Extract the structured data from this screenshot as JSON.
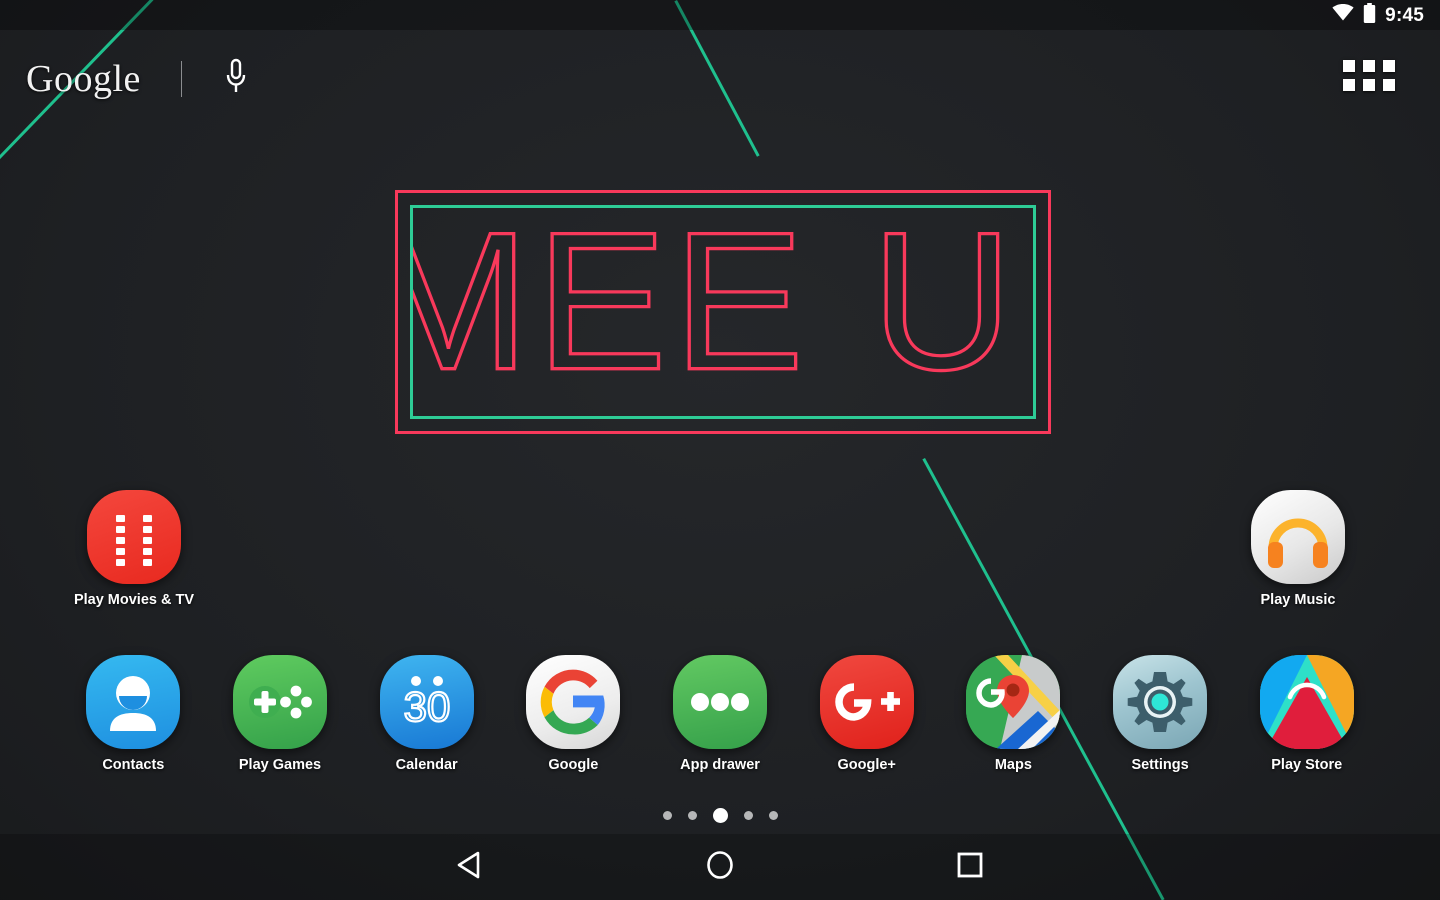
{
  "status_bar": {
    "wifi_icon": "wifi-icon",
    "battery_icon": "battery-icon",
    "time": "9:45"
  },
  "search_widget": {
    "brand": "Google",
    "mic_icon": "microphone-icon"
  },
  "drawer_button": {
    "icon": "apps-grid-icon"
  },
  "wallpaper": {
    "logo_text": "MEE UI",
    "logo_outer_color": "#f8395b",
    "logo_inner_color": "#2ecc96",
    "line_color": "#1fc08e",
    "background_color": "#1e2023"
  },
  "home_screen": {
    "top_row": [
      {
        "label": "Play Movies & TV",
        "icon": "play-movies-icon"
      },
      {
        "label": "Play Music",
        "icon": "play-music-icon"
      }
    ],
    "dock_row": [
      {
        "label": "Contacts",
        "icon": "contacts-icon"
      },
      {
        "label": "Play Games",
        "icon": "play-games-icon"
      },
      {
        "label": "Calendar",
        "icon": "calendar-icon",
        "day": "30"
      },
      {
        "label": "Google",
        "icon": "google-icon"
      },
      {
        "label": "App drawer",
        "icon": "app-drawer-icon"
      },
      {
        "label": "Google+",
        "icon": "google-plus-icon"
      },
      {
        "label": "Maps",
        "icon": "maps-icon"
      },
      {
        "label": "Settings",
        "icon": "settings-icon"
      },
      {
        "label": "Play Store",
        "icon": "play-store-icon"
      }
    ],
    "page_indicator": {
      "total": 5,
      "active": 3
    }
  },
  "nav_bar": {
    "back": "back-triangle-icon",
    "home": "home-circle-icon",
    "recents": "recents-square-icon"
  }
}
